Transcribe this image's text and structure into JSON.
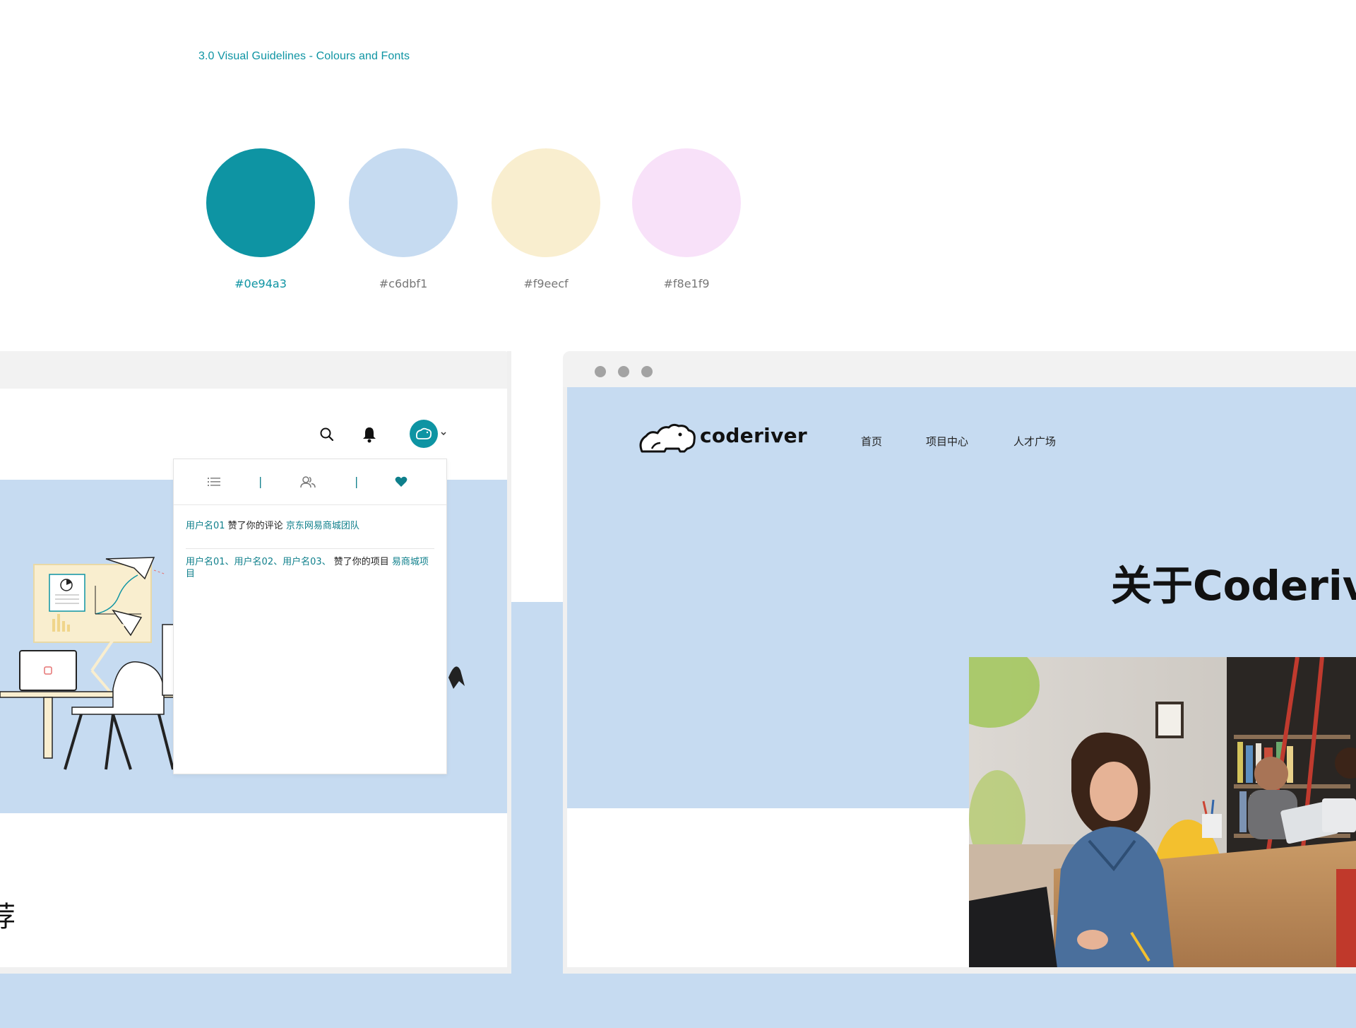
{
  "header": {
    "caption": "3.0  Visual Guidelines - Colours and Fonts"
  },
  "palette": [
    {
      "hex": "#0e94a3",
      "label": "#0e94a3",
      "label_color": "#0e94a3"
    },
    {
      "hex": "#c6dbf1",
      "label": "#c6dbf1",
      "label_color": "#777777"
    },
    {
      "hex": "#f9eecf",
      "label": "#f9eecf",
      "label_color": "#777777"
    },
    {
      "hex": "#f8e1f9",
      "label": "#f8e1f9",
      "label_color": "#777777"
    }
  ],
  "left_browser": {
    "toolbar": {
      "search_icon": "search-icon",
      "bell_icon": "bell-icon",
      "avatar_icon": "hippo-avatar-icon"
    },
    "notifications": {
      "tabs": [
        {
          "icon": "list-icon",
          "divider": "|"
        },
        {
          "icon": "users-icon",
          "divider": "|"
        },
        {
          "icon": "heart-icon"
        }
      ],
      "item1": {
        "users": "用户名01",
        "action": " 赞了你的评论 ",
        "target": "京东网易商城团队"
      },
      "item2": {
        "users": "用户名01、用户名02、用户名03、",
        "action": " 赞了你的项目 ",
        "target": "易商城项目"
      }
    },
    "partial_glyph": "荐"
  },
  "right_browser": {
    "logo": {
      "icon": "hippo-logo-icon",
      "text": "coderiver"
    },
    "nav": [
      "首页",
      "项目中心",
      "人才广场"
    ],
    "hero_title": "关于Coderiver",
    "photo": "woman-working-on-laptop-photo"
  },
  "colors": {
    "accent": "#0e94a3",
    "hero_bg": "#c6dbf1",
    "cream": "#f9eecf",
    "pink": "#f8e1f9"
  }
}
